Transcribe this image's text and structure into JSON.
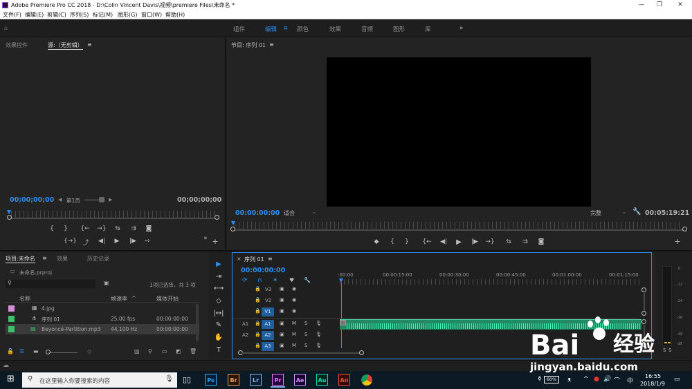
{
  "window": {
    "title": "Adobe Premiere Pro CC 2018 - D:\\Colin Vincent Davis\\视频\\premiere Files\\未命名 *",
    "minimize_icon": "minimize-icon",
    "maximize_icon": "maximize-icon",
    "close_icon": "close-icon"
  },
  "menu": [
    "文件(F)",
    "编辑(E)",
    "剪辑(C)",
    "序列(S)",
    "标记(M)",
    "图形(G)",
    "窗口(W)",
    "帮助(H)"
  ],
  "workspaces": {
    "items": [
      "组件",
      "编辑",
      "颜色",
      "效果",
      "音频",
      "图形",
      "库"
    ],
    "active": "编辑",
    "more": "»"
  },
  "source_panel": {
    "tabs": [
      "效果控件",
      "源:（无剪辑）"
    ],
    "menu_icon": "≡",
    "timecode_left": "00;00;00;00",
    "page_label": "第1页",
    "timecode_right": "00;00;00;00",
    "controls": [
      "{",
      "}",
      "{←",
      "→}",
      "⇆",
      "⇉",
      "◙"
    ],
    "controls2": [
      "{→}",
      "⤴",
      "◀|",
      "▶",
      "|▶",
      "⇨"
    ],
    "more": "»",
    "add": "+"
  },
  "program_panel": {
    "title": "节目: 序列 01",
    "menu_icon": "≡",
    "timecode_left": "00:00:00:00",
    "fit_label": "适合",
    "quality_label": "完整",
    "timecode_right": "00:05:19:21",
    "controls": [
      "◆",
      "{",
      "}",
      "{←",
      "◀|",
      "▶",
      "|▶",
      "→}",
      "⇆",
      "⇉",
      "◙"
    ],
    "add": "+"
  },
  "project_panel": {
    "tabs": [
      "项目:未命名",
      "效果",
      "历史记录"
    ],
    "menu_icon": "≡",
    "project_file": "未命名.prproj",
    "selection_info": "1项已选择，共 3 项",
    "columns": [
      "名称",
      "帧速率",
      "媒体开始"
    ],
    "items": [
      {
        "name": "4.jpg",
        "fps": "",
        "start": "",
        "color": "#d98ad9",
        "icon": "image-file-icon"
      },
      {
        "name": "序列 01",
        "fps": "25.00 fps",
        "start": "00:00:00:00",
        "color": "#3fbf6a",
        "icon": "sequence-icon"
      },
      {
        "name": "Beyoncé-Partition.mp3",
        "fps": "44,100 Hz",
        "start": "00:00:00:00",
        "color": "#3fbf6a",
        "icon": "audio-file-icon"
      }
    ]
  },
  "tools": [
    "▶",
    "⇥",
    "⟷",
    "◇",
    "|↔|",
    "✎",
    "✋",
    "T"
  ],
  "timeline": {
    "tab": "序列 01",
    "menu_icon": "≡",
    "timecode": "00:00:00:00",
    "ruler_labels": [
      ":00:00",
      "00:00:15:00",
      "00:00:30:00",
      "00:00:45:00",
      "00:01:00:00",
      "00:01:15:00"
    ],
    "video_tracks": [
      "V3",
      "V2",
      "V1"
    ],
    "audio_tracks": [
      "A1",
      "A2",
      "A3"
    ],
    "source_labels": [
      "V1",
      "A1",
      "A2"
    ],
    "m_label": "M",
    "s_label": "S"
  },
  "meter": {
    "scale": [
      "0",
      "-12",
      "-24",
      "-36",
      "-48",
      "dB"
    ],
    "solo": [
      "S",
      "S"
    ]
  },
  "taskbar": {
    "search_placeholder": "在这里输入你要搜索的内容",
    "apps": [
      {
        "label": "Ps",
        "color": "#31a8ff",
        "bg": "#001e36"
      },
      {
        "label": "Br",
        "color": "#e8a045",
        "bg": "#2a1600"
      },
      {
        "label": "Lr",
        "color": "#8bb8e8",
        "bg": "#0a1e33"
      },
      {
        "label": "Pr",
        "color": "#ea77ff",
        "bg": "#2a003a"
      },
      {
        "label": "Ae",
        "color": "#d291ff",
        "bg": "#1a0033"
      },
      {
        "label": "Au",
        "color": "#00e4bb",
        "bg": "#00261c"
      },
      {
        "label": "An",
        "color": "#ff4d3a",
        "bg": "#330a00"
      }
    ],
    "battery": "60%",
    "ime": "中",
    "time": "16:55",
    "date": "2018/1/9"
  },
  "watermark": {
    "brand": "Bai",
    "brand_cn": "经验",
    "url": "jingyan.baidu.com"
  }
}
